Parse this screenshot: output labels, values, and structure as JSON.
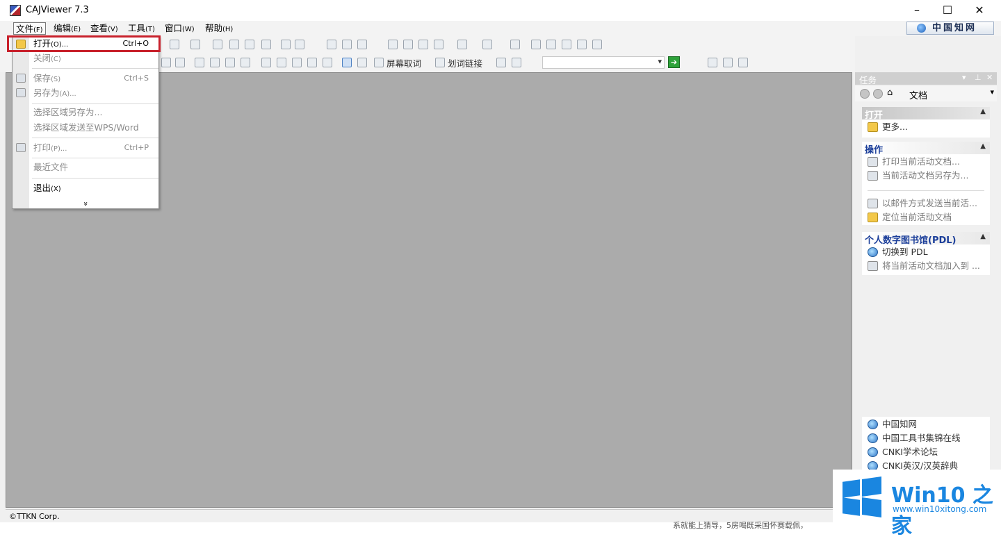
{
  "window": {
    "title": "CAJViewer 7.3",
    "controls": {
      "minimize": "–",
      "maximize": "☐",
      "close": "✕"
    }
  },
  "menubar": {
    "items": [
      {
        "label": "文件",
        "key": "(F)"
      },
      {
        "label": "编辑",
        "key": "(E)"
      },
      {
        "label": "查看",
        "key": "(V)"
      },
      {
        "label": "工具",
        "key": "(T)"
      },
      {
        "label": "窗口",
        "key": "(W)"
      },
      {
        "label": "帮助",
        "key": "(H)"
      }
    ],
    "brand": "中国知网"
  },
  "toolbar": {
    "screen_capture": "屏幕取词",
    "word_link": "划词链接"
  },
  "file_menu": {
    "items": [
      {
        "label": "打开",
        "key": "(O)...",
        "shortcut": "Ctrl+O",
        "icon": "open-folder-icon"
      },
      {
        "label": "关闭",
        "key": "(C)",
        "shortcut": ""
      },
      {
        "label": "保存",
        "key": "(S)",
        "shortcut": "Ctrl+S",
        "icon": "save-icon"
      },
      {
        "label": "另存为",
        "key": "(A)...",
        "shortcut": "",
        "icon": "save-as-icon"
      },
      {
        "label": "选择区域另存为...",
        "key": "",
        "shortcut": ""
      },
      {
        "label": "选择区域发送至WPS/Word",
        "key": "",
        "shortcut": ""
      },
      {
        "label": "打印",
        "key": "(P)...",
        "shortcut": "Ctrl+P",
        "icon": "print-icon"
      },
      {
        "label": "最近文件",
        "key": "",
        "shortcut": ""
      },
      {
        "label": "退出",
        "key": "(X)",
        "shortcut": ""
      }
    ],
    "expand": "»"
  },
  "task_pane": {
    "title": "任务",
    "nav_label": "文档",
    "sections": {
      "open": {
        "title": "打开",
        "links": [
          "更多..."
        ]
      },
      "operations": {
        "title": "操作",
        "links": [
          "打印当前活动文档...",
          "当前活动文档另存为...",
          "以邮件方式发送当前活...",
          "定位当前活动文档"
        ]
      },
      "pdl": {
        "title": "个人数字图书馆(PDL)",
        "links": [
          "切换到 PDL",
          "将当前活动文档加入到 ..."
        ]
      }
    },
    "web_links": [
      "中国知网",
      "中国工具书集锦在线",
      "CNKI学术论坛",
      "CNKI英汉/汉英辞典"
    ]
  },
  "statusbar": {
    "text": "©TTKN Corp."
  },
  "background_text": "系就能上猜导，5房喝既采国怀赛载佩，",
  "watermark": {
    "title": "Win10 之家",
    "url": "www.win10xitong.com"
  },
  "colors": {
    "highlight": "#c8202b",
    "accent": "#1a86e0",
    "doc_bg": "#ababab"
  }
}
